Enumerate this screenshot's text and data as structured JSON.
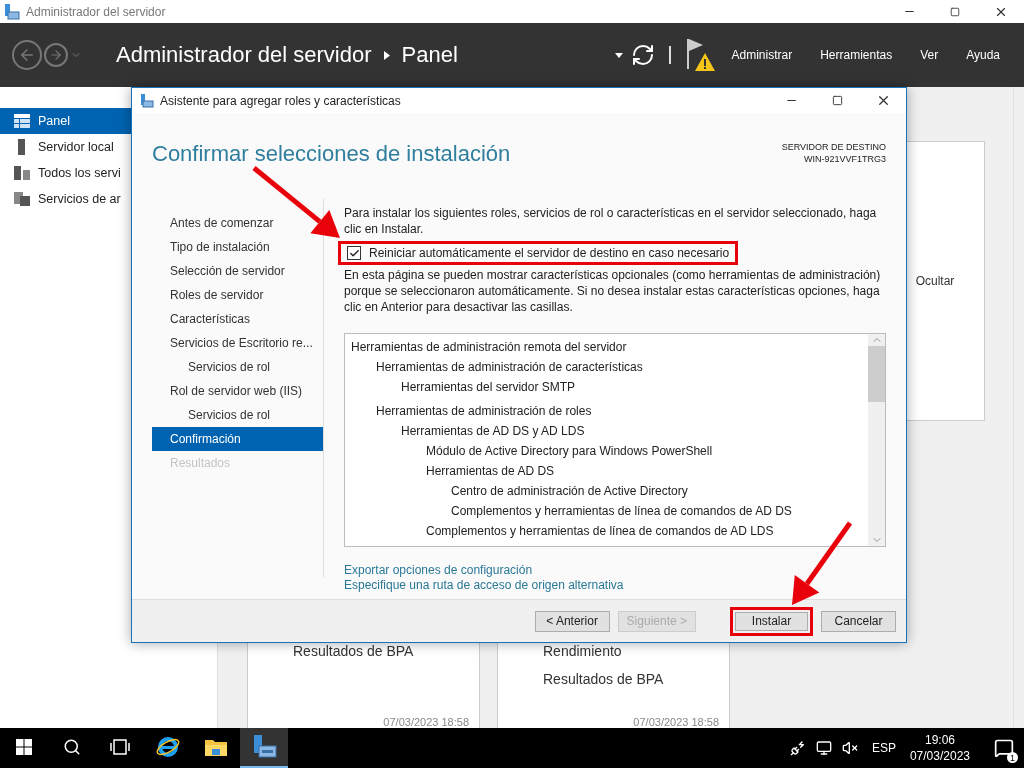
{
  "window": {
    "title": "Administrador del servidor"
  },
  "header": {
    "breadcrumb": [
      "Administrador del servidor",
      "Panel"
    ],
    "menu": [
      "Administrar",
      "Herramientas",
      "Ver",
      "Ayuda"
    ]
  },
  "sidebar": {
    "items": [
      {
        "label": "Panel",
        "kind": "dashboard",
        "selected": true
      },
      {
        "label": "Servidor local",
        "kind": "server",
        "selected": false
      },
      {
        "label": "Todos los servi",
        "kind": "servers",
        "selected": false
      },
      {
        "label": "Servicios de ar",
        "kind": "files",
        "selected": false
      }
    ]
  },
  "tiles": {
    "hide_label": "Ocultar",
    "cards": [
      {
        "items": [
          "Resultados de BPA"
        ],
        "timestamp": "07/03/2023 18:58"
      },
      {
        "items": [
          "Rendimiento",
          "Resultados de BPA"
        ],
        "timestamp": "07/03/2023 18:58"
      }
    ]
  },
  "dialog": {
    "title": "Asistente para agregar roles y características",
    "heading": "Confirmar selecciones de instalación",
    "target_label": "SERVIDOR DE DESTINO",
    "target_server": "WIN-921VVF1TRG3",
    "steps": [
      {
        "label": "Antes de comenzar",
        "selected": false,
        "disabled": false
      },
      {
        "label": "Tipo de instalación",
        "selected": false,
        "disabled": false
      },
      {
        "label": "Selección de servidor",
        "selected": false,
        "disabled": false
      },
      {
        "label": "Roles de servidor",
        "selected": false,
        "disabled": false
      },
      {
        "label": "Características",
        "selected": false,
        "disabled": false
      },
      {
        "label": "Servicios de Escritorio re...",
        "selected": false,
        "disabled": false,
        "children": [
          {
            "label": "Servicios de rol",
            "selected": false,
            "disabled": false
          }
        ]
      },
      {
        "label": "Rol de servidor web (IIS)",
        "selected": false,
        "disabled": false,
        "children": [
          {
            "label": "Servicios de rol",
            "selected": false,
            "disabled": false
          }
        ]
      },
      {
        "label": "Confirmación",
        "selected": true,
        "disabled": false
      },
      {
        "label": "Resultados",
        "selected": false,
        "disabled": true
      }
    ],
    "intro": "Para instalar los siguientes roles, servicios de rol o características en el servidor seleccionado, haga clic en Instalar.",
    "restart": {
      "label": "Reiniciar automáticamente el servidor de destino en caso necesario",
      "checked": true,
      "annotated": true
    },
    "note": "En esta página se pueden mostrar características opcionales (como herramientas de administración) porque se seleccionaron automáticamente. Si no desea instalar estas características opciones, haga clic en Anterior para desactivar las casillas.",
    "features": [
      {
        "label": "Herramientas de administración remota del servidor",
        "children": [
          {
            "label": "Herramientas de administración de características",
            "children": [
              {
                "label": "Herramientas del servidor SMTP"
              }
            ]
          },
          {
            "label": "Herramientas de administración de roles",
            "children": [
              {
                "label": "Herramientas de AD DS y AD LDS",
                "children": [
                  {
                    "label": "Módulo de Active Directory para Windows PowerShell"
                  },
                  {
                    "label": "Herramientas de AD DS",
                    "children": [
                      {
                        "label": "Centro de administración de Active Directory"
                      },
                      {
                        "label": "Complementos y herramientas de línea de comandos de AD DS"
                      }
                    ]
                  },
                  {
                    "label": "Complementos y herramientas de línea de comandos de AD LDS"
                  }
                ]
              }
            ]
          }
        ]
      }
    ],
    "links": [
      "Exportar opciones de configuración",
      "Especifique una ruta de acceso de origen alternativa"
    ],
    "buttons": [
      {
        "label": "< Anterior",
        "disabled": false,
        "annotated": false
      },
      {
        "label": "Siguiente >",
        "disabled": true,
        "annotated": false
      },
      {
        "label": "Instalar",
        "disabled": false,
        "annotated": true
      },
      {
        "label": "Cancelar",
        "disabled": false,
        "annotated": false
      }
    ]
  },
  "taskbar": {
    "apps": [
      {
        "kind": "start",
        "selected": false
      },
      {
        "kind": "search",
        "selected": false
      },
      {
        "kind": "taskview",
        "selected": false
      },
      {
        "kind": "browser",
        "selected": false
      },
      {
        "kind": "folder",
        "selected": false
      },
      {
        "kind": "servermanager",
        "selected": true
      }
    ],
    "language": "ESP",
    "time": "19:06",
    "date": "07/03/2023",
    "notification_count": "1"
  }
}
